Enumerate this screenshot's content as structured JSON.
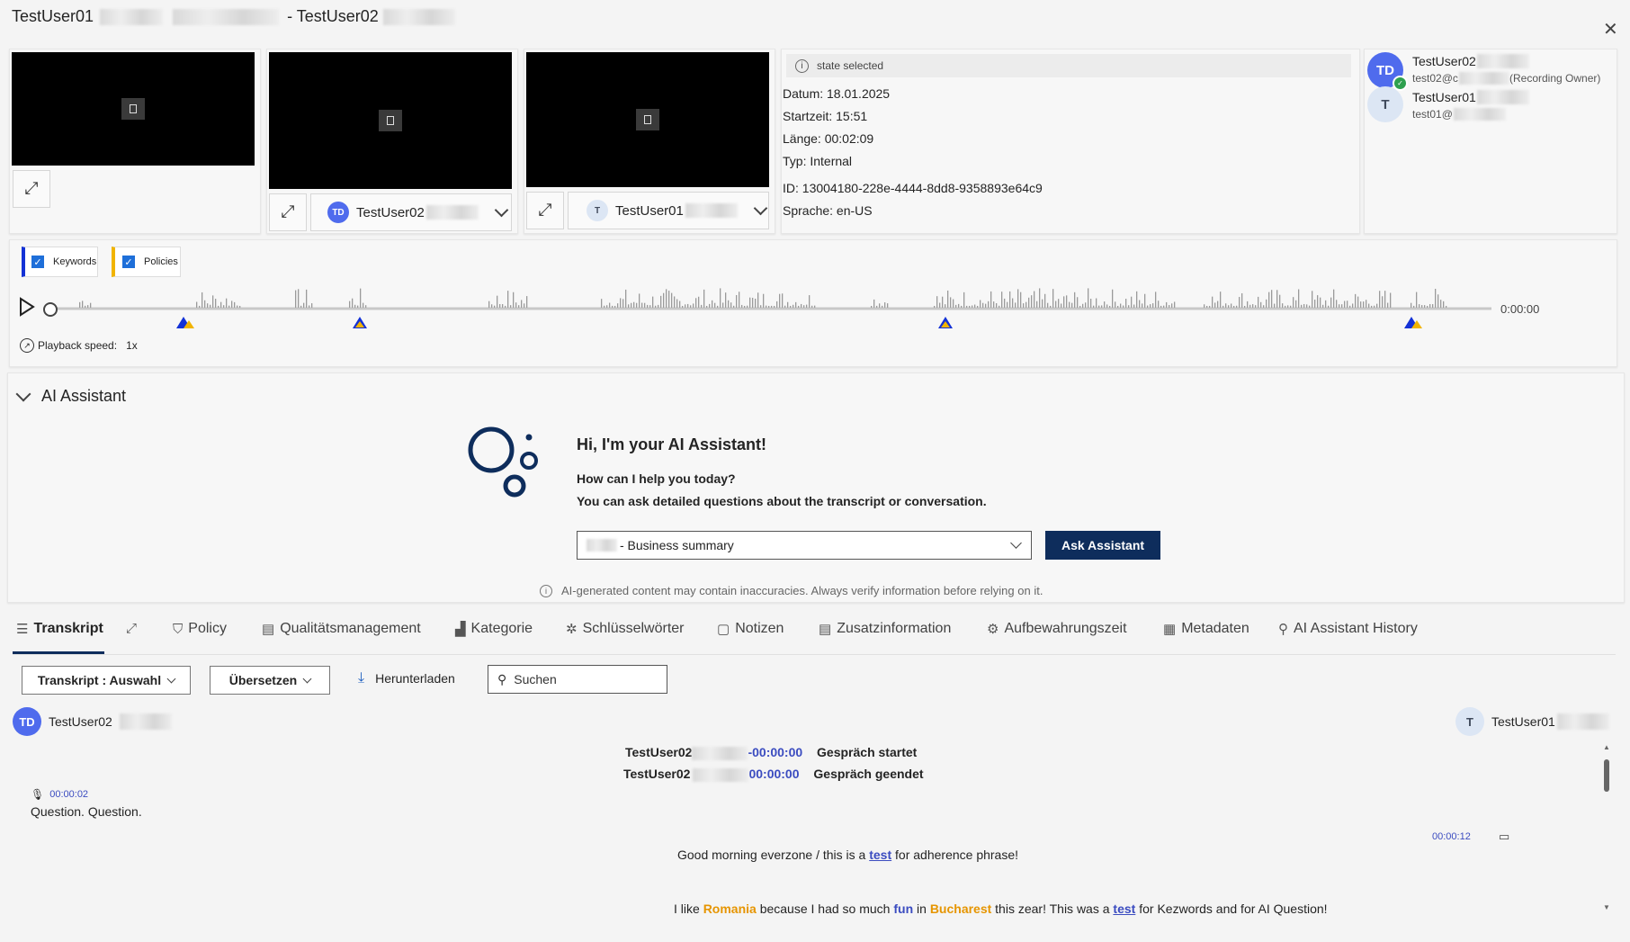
{
  "window": {
    "title_left": "TestUser01",
    "title_sep": "- TestUser02",
    "close_label": "✕"
  },
  "videos": [
    {
      "participant": "",
      "avatar": ""
    },
    {
      "participant": "TestUser02",
      "avatar": "TD"
    },
    {
      "participant": "TestUser01",
      "avatar": "T"
    }
  ],
  "meta": {
    "state": "state selected",
    "datum": "Datum: 18.01.2025",
    "startzeit": "Startzeit: 15:51",
    "laenge": "Länge: 00:02:09",
    "typ": "Typ: Internal",
    "id": "ID: 13004180-228e-4444-8dd8-9358893e64c9",
    "sprache": "Sprache: en-US"
  },
  "participants": [
    {
      "initials": "TD",
      "name": "TestUser02",
      "email": "test02@c",
      "role": "Recording Owner)",
      "online": true
    },
    {
      "initials": "T",
      "name": "TestUser01",
      "email": "test01@",
      "role": "",
      "online": false
    }
  ],
  "filters": {
    "keywords": "Keywords",
    "policies": "Policies",
    "colors": {
      "keywords": "#1432d6",
      "policies": "#f1b400"
    }
  },
  "playback": {
    "time": "0:00:00",
    "speed_label": "Playback speed:",
    "speed_value": "1x"
  },
  "ai": {
    "section_title": "AI Assistant",
    "greeting": "Hi, I'm your AI Assistant!",
    "help": "How can I help you today?",
    "detail": "You can ask detailed questions about the transcript or conversation.",
    "select_value": "- Business summary",
    "ask_button": "Ask Assistant",
    "disclaimer": "AI-generated content may contain inaccuracies. Always verify information before relying on it.",
    "accent": "#0e2d5c"
  },
  "tabs": [
    {
      "label": "Transkript",
      "icon": "list-icon",
      "glyph": "☰"
    },
    {
      "label": "",
      "icon": "expand-icon",
      "glyph": "⤢"
    },
    {
      "label": "Policy",
      "icon": "shield-icon",
      "glyph": "⛉"
    },
    {
      "label": "Qualitätsmanagement",
      "icon": "clipboard-icon",
      "glyph": "▤"
    },
    {
      "label": "Kategorie",
      "icon": "chart-icon",
      "glyph": "▟"
    },
    {
      "label": "Schlüsselwörter",
      "icon": "gear-star-icon",
      "glyph": "✲"
    },
    {
      "label": "Notizen",
      "icon": "note-icon",
      "glyph": "▢"
    },
    {
      "label": "Zusatzinformation",
      "icon": "clipboard-info-icon",
      "glyph": "▤"
    },
    {
      "label": "Aufbewahrungszeit",
      "icon": "gear-icon",
      "glyph": "⚙"
    },
    {
      "label": "Metadaten",
      "icon": "table-icon",
      "glyph": "▦"
    },
    {
      "label": "AI Assistant History",
      "icon": "ai-history-icon",
      "glyph": "⚲"
    }
  ],
  "toolbar": {
    "transcript_select": "Transkript : Auswahl",
    "translate": "Übersetzen",
    "download": "Herunterladen",
    "search_placeholder": "Suchen"
  },
  "transcript": {
    "left_speaker": {
      "initials": "TD",
      "name": "TestUser02"
    },
    "right_speaker": {
      "initials": "T",
      "name": "TestUser01"
    },
    "events": [
      {
        "speaker": "TestUser02",
        "time": "-00:00:00",
        "text": "Gespräch startet"
      },
      {
        "speaker": "TestUser02",
        "time": "00:00:00",
        "text": "Gespräch geendet"
      }
    ],
    "left_msg_time": "00:00:02",
    "left_msg_text": "Question. Question.",
    "right_msg_time": "00:00:12",
    "line1": {
      "a": "Good morning everzone / this is a",
      "kw": "test",
      "b": "for adherence phrase!"
    },
    "line2": {
      "a": "I like",
      "romania": "Romania",
      "b": "because I had so much",
      "fun": "fun",
      "c": "in",
      "bucharest": "Bucharest",
      "d": "this zear! This was a",
      "kw": "test",
      "e": "for Kezwords and for AI Question!"
    }
  }
}
